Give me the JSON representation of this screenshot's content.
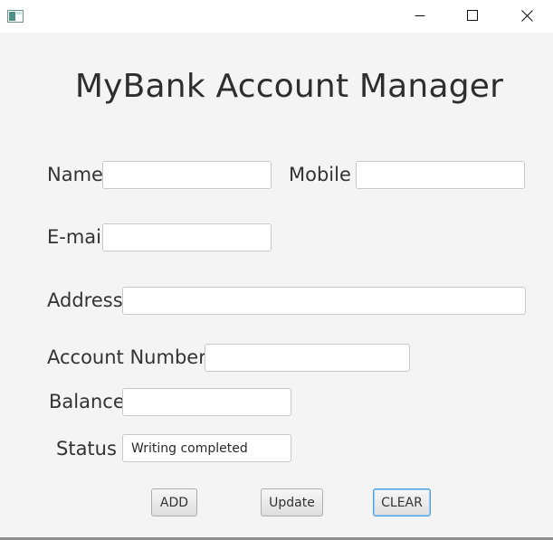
{
  "window": {
    "minimize_icon": "minimize-icon",
    "maximize_icon": "maximize-icon",
    "close_icon": "close-icon"
  },
  "form": {
    "title": "MyBank Account Manager",
    "name_label": "Name",
    "name_value": "",
    "mobile_label": "Mobile",
    "mobile_value": "",
    "email_label": "E-mail",
    "email_value": "",
    "address_label": "Address",
    "address_value": "",
    "account_number_label": "Account Number",
    "account_number_value": "",
    "balance_label": "Balance",
    "balance_value": "",
    "status_label": "Status",
    "status_value": "Writing completed"
  },
  "buttons": {
    "add": "ADD",
    "update": "Update",
    "clear": "CLEAR"
  },
  "colors": {
    "background": "#f4f4f4",
    "focus_accent": "#4a9fe0"
  }
}
